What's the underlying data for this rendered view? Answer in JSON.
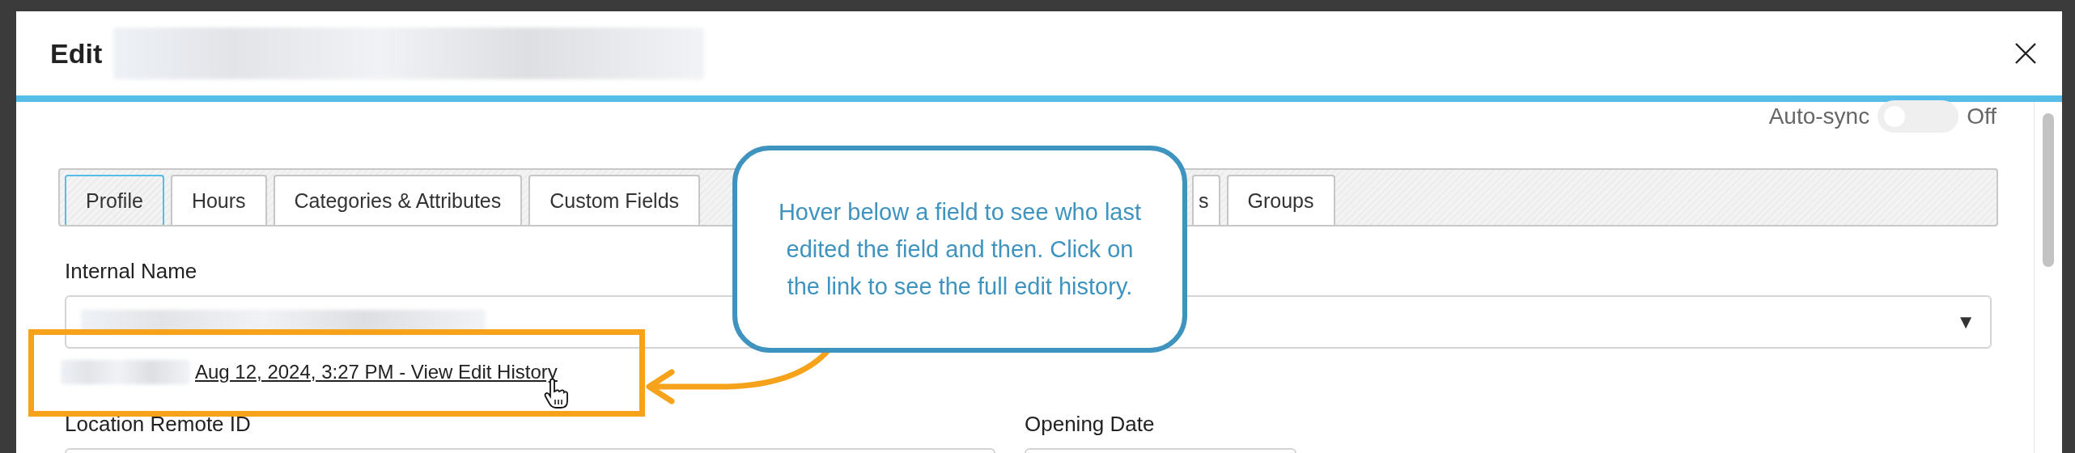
{
  "dialog": {
    "title": "Edit"
  },
  "auto_sync": {
    "label": "Auto-sync",
    "on": false,
    "state_text": "Off"
  },
  "tabs": [
    {
      "label": "Profile",
      "selected": true
    },
    {
      "label": "Hours",
      "selected": false
    },
    {
      "label": "Categories & Attributes",
      "selected": false
    },
    {
      "label": "Custom Fields",
      "selected": false
    },
    {
      "label": "s",
      "selected": false
    },
    {
      "label": "Groups",
      "selected": false
    }
  ],
  "internal_name": {
    "label": "Internal Name",
    "kind": "select",
    "caret": "▼"
  },
  "edit_history": {
    "link": "Aug 12, 2024, 3:27 PM - View Edit History"
  },
  "fields": [
    {
      "label": "Location Remote ID",
      "kind": "text"
    },
    {
      "label": "Opening Date",
      "kind": "text"
    }
  ],
  "callout": {
    "text": "Hover below a field to see who last\nedited the field and then. Click on\nthe link to see the full edit history."
  }
}
